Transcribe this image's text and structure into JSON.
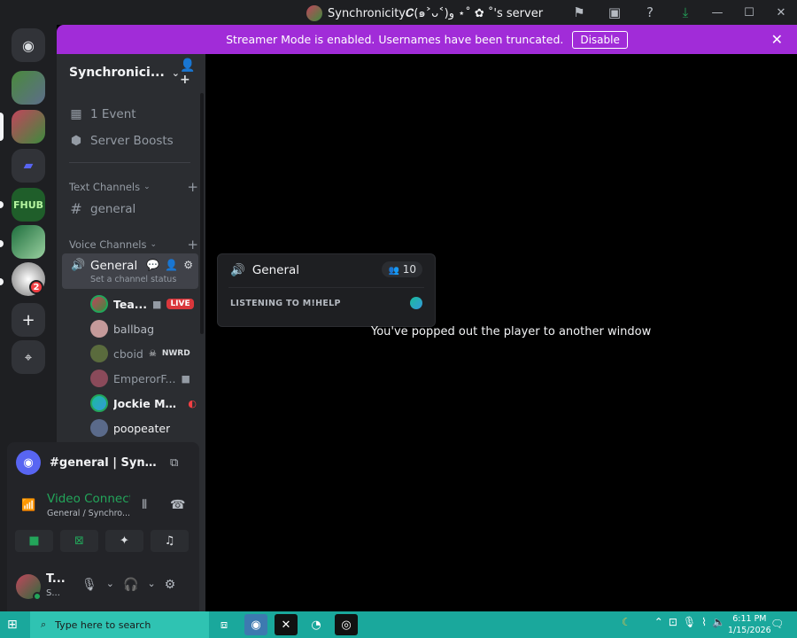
{
  "window": {
    "title": "Synchronicity𝑪(๑˃ᴗ˂)ﻭ ⋆˚ ✿ ˚'s server",
    "icons": [
      "flag-icon",
      "inbox-icon",
      "help-icon",
      "download-icon"
    ],
    "controls": [
      "—",
      "☐",
      "✕"
    ]
  },
  "rail": {
    "badge": "2"
  },
  "banner": {
    "text": "Streamer Mode is enabled. Usernames have been truncated.",
    "disable_label": "Disable"
  },
  "sidebar": {
    "server_name": "Synchronici...",
    "events": "1 Event",
    "boosts": "Server Boosts",
    "text_category": "Text Channels",
    "text_channel": "general",
    "voice_category": "Voice Channels",
    "voice_channel": "General",
    "voice_status": "Set a channel status",
    "members": [
      {
        "name": "Tea...",
        "tag": "LIVE"
      },
      {
        "name": "ballbag",
        "tag": ""
      },
      {
        "name": "cboid",
        "tag": "NWRD"
      },
      {
        "name": "EmperorF...",
        "tag": ""
      },
      {
        "name": "Jockie Mu...",
        "tag": ""
      },
      {
        "name": "poopeater",
        "tag": ""
      }
    ]
  },
  "panel": {
    "pip_title": "#general | Synchro...",
    "voice_status": "Video Connected",
    "voice_sub": "General / Synchro...",
    "user_name": "T...",
    "user_status": "S..."
  },
  "popup": {
    "channel": "General",
    "count": "10",
    "activity": "LISTENING TO M!HELP"
  },
  "main": {
    "message": "You've popped out the player to another window"
  },
  "taskbar": {
    "search_placeholder": "Type here to search",
    "time": "6:11 PM",
    "date": "1/15/2026"
  }
}
